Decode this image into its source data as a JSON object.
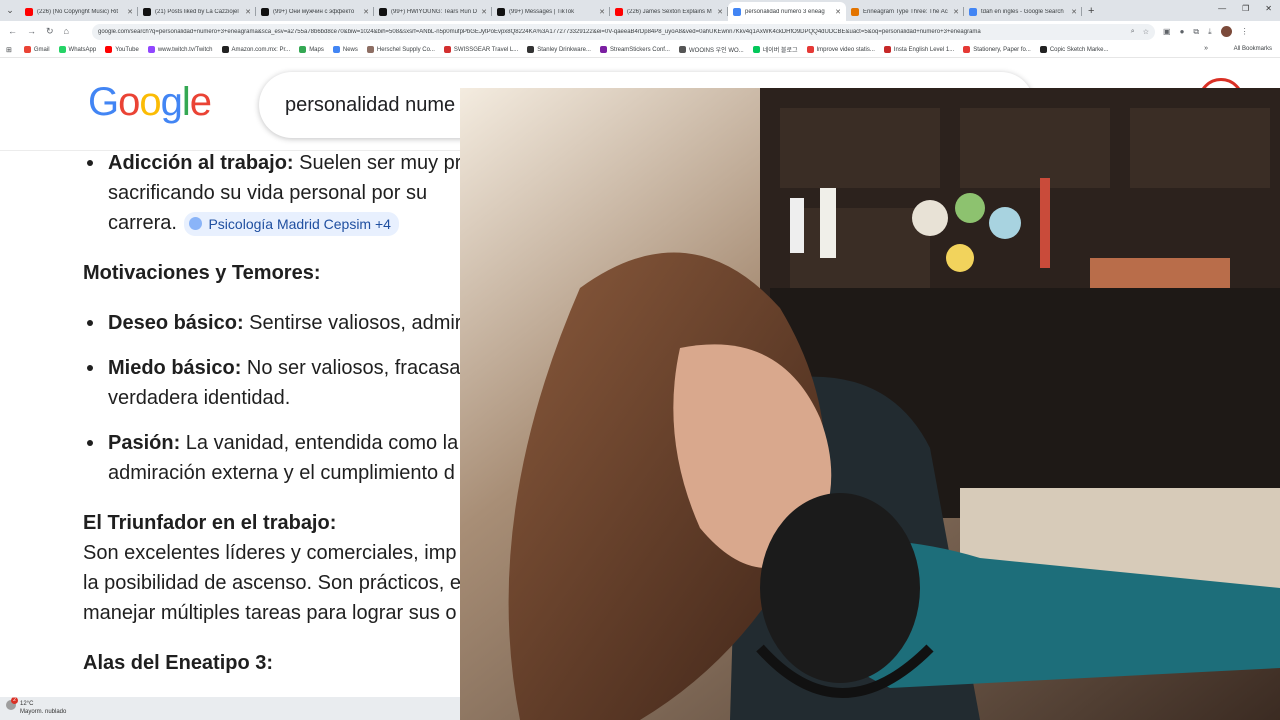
{
  "browser": {
    "tabs": [
      {
        "title": "(226) (No Copyright Music) Rit",
        "color": "#ff0000"
      },
      {
        "title": "(21) Posts liked by La Cazziojel",
        "color": "#111111"
      },
      {
        "title": "(99+) Они мужчин с эффекто",
        "color": "#111111"
      },
      {
        "title": "(99+) HWIYOUNG: Tears Run D",
        "color": "#111111"
      },
      {
        "title": "(99+) Messages | TikTok",
        "color": "#111111"
      },
      {
        "title": "(226) James Sexton Explains M",
        "color": "#ff0000"
      },
      {
        "title": "personalidad numero 3 eneag",
        "color": "#4285f4",
        "active": true
      },
      {
        "title": "Enneagram Type Three: The Ac",
        "color": "#e37400"
      },
      {
        "title": "tdah en ingles - Google Search",
        "color": "#4285f4"
      }
    ],
    "new_tab": "+",
    "url": "google.com/search?q=personalidad+numero+3+eneagrama&sca_esv=a2755a78b6bd8ce70&biw=1024&bih=508&sxsrf=ANbL-n5p0mufpPbGEJytPoEvpx8Q8224KA%3A1772773329122&ei=0V-qaeeaB4rDp84P8_uyoA8&ved=0ahUKEwnn7Kkv4q1AxWK4ckDHfO9DPQQ4dUDCBE&uact=5&oq=personalidad+numero+3+eneagrama",
    "bookmarks": [
      {
        "label": "Gmail",
        "color": "#ea4335"
      },
      {
        "label": "WhatsApp",
        "color": "#25d366"
      },
      {
        "label": "YouTube",
        "color": "#ff0000"
      },
      {
        "label": "www.twitch.tv/Twitch",
        "color": "#9146ff"
      },
      {
        "label": "Amazon.com.mx: Pr...",
        "color": "#222222"
      },
      {
        "label": "Maps",
        "color": "#34a853"
      },
      {
        "label": "News",
        "color": "#4285f4"
      },
      {
        "label": "Herschel Supply Co...",
        "color": "#8d6e63"
      },
      {
        "label": "SWISSGEAR Travel L...",
        "color": "#d32f2f"
      },
      {
        "label": "Stanley Drinkware...",
        "color": "#333333"
      },
      {
        "label": "StreamStickers Conf...",
        "color": "#7b1fa2"
      },
      {
        "label": "WOOINS 우인 WO...",
        "color": "#555555"
      },
      {
        "label": "네이버 블로그",
        "color": "#03c75a"
      },
      {
        "label": "Improve video statis...",
        "color": "#e53935"
      },
      {
        "label": "Insta English Level 1...",
        "color": "#c62828"
      },
      {
        "label": "Stationery, Paper fo...",
        "color": "#e53935"
      },
      {
        "label": "Copic Sketch Marke...",
        "color": "#222222"
      }
    ],
    "all_bookmarks": "All Bookmarks"
  },
  "search": {
    "logo": "Google",
    "query": "personalidad nume"
  },
  "article": {
    "b1_label": "Adicción al trabajo:",
    "b1_text_a": " Suelen ser muy pr",
    "b1_text_b": "sacrificando su vida personal por su",
    "b1_text_c": "carrera.",
    "chip": "Psicología Madrid Cepsim +4",
    "h1": "Motivaciones y Temores:",
    "b2_label": "Deseo básico:",
    "b2_text": " Sentirse valiosos, admir",
    "b3_label": "Miedo básico:",
    "b3_text_a": " No ser valiosos, fracasa",
    "b3_text_b": "verdadera identidad.",
    "b4_label": "Pasión:",
    "b4_text_a": " La vanidad, entendida como la",
    "b4_text_b": "admiración externa y el cumplimiento d",
    "h2": "El Triunfador en el trabajo:",
    "p1": "Son excelentes líderes y comerciales, imp",
    "p2": "la posibilidad de ascenso. Son prácticos, e",
    "p3": "manejar múltiples tareas para lograr sus o",
    "h3": "Alas del Eneatipo 3:"
  },
  "taskbar": {
    "temp": "12°C",
    "condition": "Mayorm. nublado",
    "badge": "2"
  }
}
